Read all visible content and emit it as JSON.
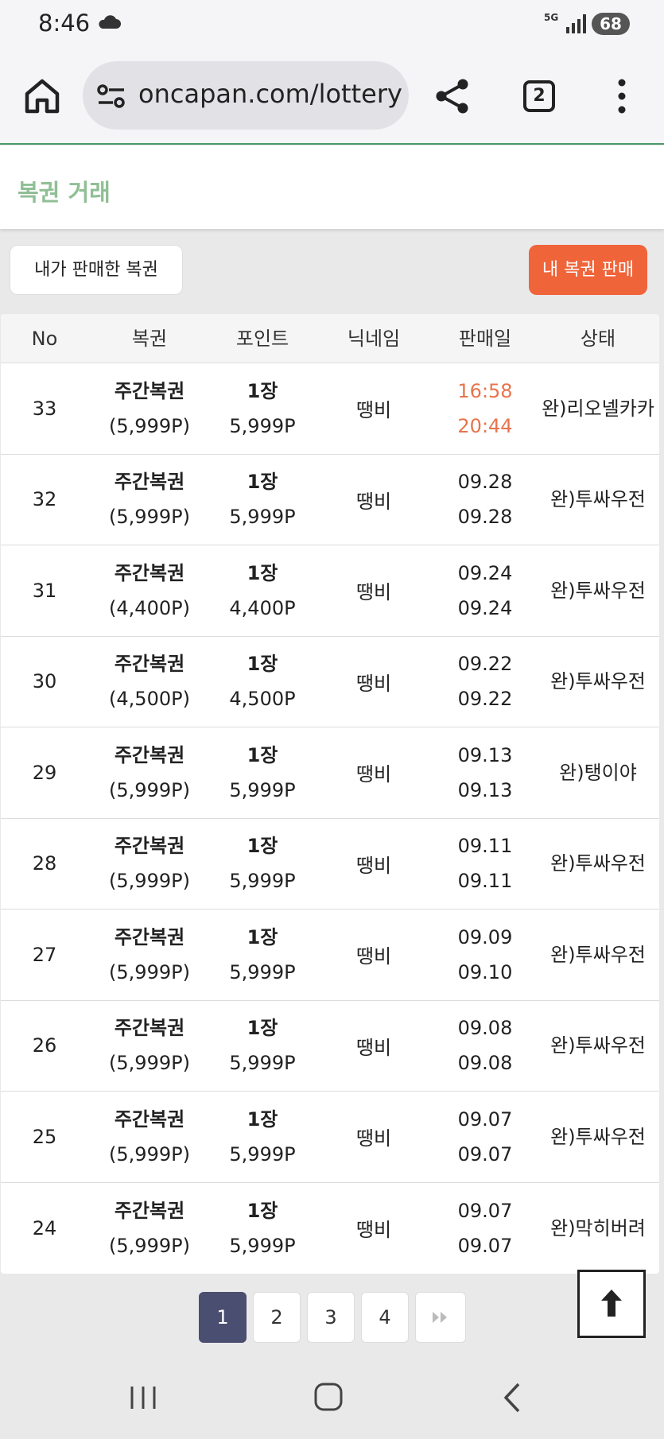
{
  "status_bar": {
    "time": "8:46",
    "network": "5G",
    "battery": "68"
  },
  "browser": {
    "url": "oncapan.com/lottery",
    "tab_count": "2"
  },
  "page": {
    "title": "복권 거래"
  },
  "actions": {
    "my_sold_label": "내가 판매한 복권",
    "sell_label": "내 복권 판매"
  },
  "table": {
    "headers": [
      "No",
      "복권",
      "포인트",
      "닉네임",
      "판매일",
      "상태"
    ],
    "rows": [
      {
        "no": "33",
        "lottery": "주간복권",
        "price": "(5,999P)",
        "qty": "1장",
        "points": "5,999P",
        "nickname": "땡비",
        "date1": "16:58",
        "date2": "20:44",
        "status": "완)리오넬카카",
        "highlight": true
      },
      {
        "no": "32",
        "lottery": "주간복권",
        "price": "(5,999P)",
        "qty": "1장",
        "points": "5,999P",
        "nickname": "땡비",
        "date1": "09.28",
        "date2": "09.28",
        "status": "완)투싸우전",
        "highlight": false
      },
      {
        "no": "31",
        "lottery": "주간복권",
        "price": "(4,400P)",
        "qty": "1장",
        "points": "4,400P",
        "nickname": "땡비",
        "date1": "09.24",
        "date2": "09.24",
        "status": "완)투싸우전",
        "highlight": false
      },
      {
        "no": "30",
        "lottery": "주간복권",
        "price": "(4,500P)",
        "qty": "1장",
        "points": "4,500P",
        "nickname": "땡비",
        "date1": "09.22",
        "date2": "09.22",
        "status": "완)투싸우전",
        "highlight": false
      },
      {
        "no": "29",
        "lottery": "주간복권",
        "price": "(5,999P)",
        "qty": "1장",
        "points": "5,999P",
        "nickname": "땡비",
        "date1": "09.13",
        "date2": "09.13",
        "status": "완)탱이야",
        "highlight": false
      },
      {
        "no": "28",
        "lottery": "주간복권",
        "price": "(5,999P)",
        "qty": "1장",
        "points": "5,999P",
        "nickname": "땡비",
        "date1": "09.11",
        "date2": "09.11",
        "status": "완)투싸우전",
        "highlight": false
      },
      {
        "no": "27",
        "lottery": "주간복권",
        "price": "(5,999P)",
        "qty": "1장",
        "points": "5,999P",
        "nickname": "땡비",
        "date1": "09.09",
        "date2": "09.10",
        "status": "완)투싸우전",
        "highlight": false
      },
      {
        "no": "26",
        "lottery": "주간복권",
        "price": "(5,999P)",
        "qty": "1장",
        "points": "5,999P",
        "nickname": "땡비",
        "date1": "09.08",
        "date2": "09.08",
        "status": "완)투싸우전",
        "highlight": false
      },
      {
        "no": "25",
        "lottery": "주간복권",
        "price": "(5,999P)",
        "qty": "1장",
        "points": "5,999P",
        "nickname": "땡비",
        "date1": "09.07",
        "date2": "09.07",
        "status": "완)투싸우전",
        "highlight": false
      },
      {
        "no": "24",
        "lottery": "주간복권",
        "price": "(5,999P)",
        "qty": "1장",
        "points": "5,999P",
        "nickname": "땡비",
        "date1": "09.07",
        "date2": "09.07",
        "status": "완)막히버려",
        "highlight": false
      }
    ]
  },
  "pagination": {
    "pages": [
      "1",
      "2",
      "3",
      "4"
    ],
    "current": "1",
    "last_icon": "double-chevron-right-icon"
  },
  "colors": {
    "accent": "#f0643a",
    "title_green": "#8fbf94",
    "pager_active": "#4a4e70",
    "date_highlight": "#e8734d"
  }
}
